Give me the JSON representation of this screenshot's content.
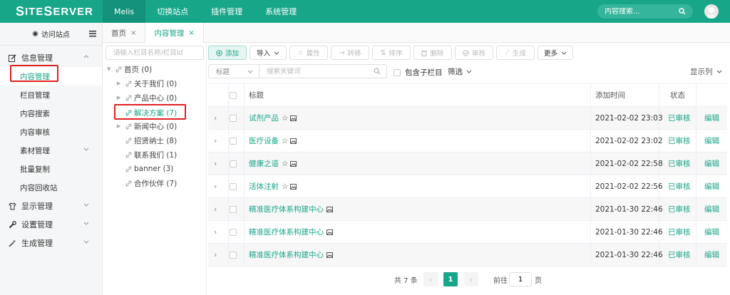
{
  "header": {
    "logo": "SiteServer",
    "nav": [
      "Melis",
      "切换站点",
      "插件管理",
      "系统管理"
    ],
    "search_placeholder": "内容搜索..."
  },
  "sidebar": {
    "visit_site": "访问站点",
    "groups": {
      "info": "信息管理",
      "display": "显示管理",
      "settings": "设置管理",
      "generate": "生成管理"
    },
    "items": [
      "内容管理",
      "栏目管理",
      "内容搜索",
      "内容审核",
      "素材管理",
      "批量复制",
      "内容回收站"
    ]
  },
  "tabs": [
    {
      "label": "首页",
      "close": "×"
    },
    {
      "label": "内容管理",
      "close": "×"
    }
  ],
  "tree": {
    "search_placeholder": "请输入栏目名称/栏目Id",
    "nodes": [
      "首页 (0)",
      "关于我们 (0)",
      "产品中心 (0)",
      "解决方案 (7)",
      "新闻中心 (0)",
      "招贤纳士 (8)",
      "联系我们 (1)",
      "banner (3)",
      "合作伙伴 (7)"
    ]
  },
  "toolbar": {
    "add": "添加",
    "import": "导入",
    "attributes": "属性",
    "transfer": "转移",
    "sort": "排序",
    "delete": "删除",
    "review": "审核",
    "generate": "生成",
    "more": "更多"
  },
  "filter": {
    "field": "标题",
    "keyword_placeholder": "搜索关键词",
    "include_sub": "包含子栏目",
    "screen": "筛选",
    "show_columns": "显示列"
  },
  "table": {
    "headers": {
      "title": "标题",
      "added": "添加时间",
      "status": "状态"
    },
    "rows": [
      {
        "title": "试剂产品",
        "time": "2021-02-02 23:03",
        "status": "已审核",
        "action": "编辑"
      },
      {
        "title": "医疗设备",
        "time": "2021-02-02 23:02",
        "status": "已审核",
        "action": "编辑"
      },
      {
        "title": "健康之道",
        "time": "2021-02-02 22:58",
        "status": "已审核",
        "action": "编辑"
      },
      {
        "title": "活体注射",
        "time": "2021-02-02 22:56",
        "status": "已审核",
        "action": "编辑"
      },
      {
        "title": "精准医疗体系构建中心",
        "time": "2021-01-30 22:46",
        "status": "已审核",
        "action": "编辑"
      },
      {
        "title": "精准医疗体系构建中心",
        "time": "2021-01-30 22:46",
        "status": "已审核",
        "action": "编辑"
      },
      {
        "title": "精准医疗体系构建中心",
        "time": "2021-01-30 22:46",
        "status": "已审核",
        "action": "编辑"
      }
    ]
  },
  "pagination": {
    "total": "共 7 条",
    "current": "1",
    "goto": "前往",
    "goto_value": "1",
    "page": "页"
  },
  "colors": {
    "accent": "#18a689",
    "highlight": "#e02020"
  }
}
